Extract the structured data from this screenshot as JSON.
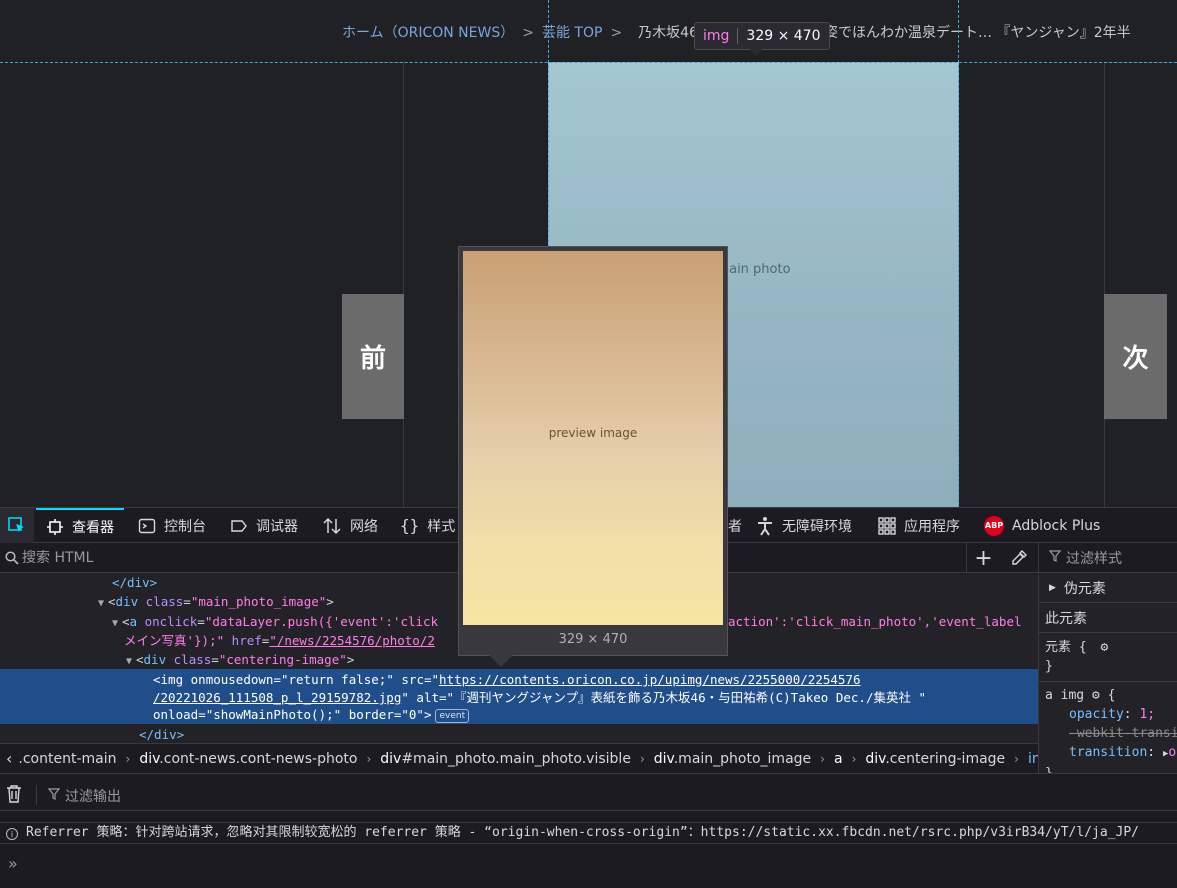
{
  "page": {
    "breadcrumb": {
      "home": "ホーム（ORICON NEWS）",
      "sep": ">",
      "category": "芸能 TOP",
      "current": "乃木坂46・与田祐希、メガネ姿でほんわか温泉デート… 『ヤンジャン』2年半"
    },
    "prev_label": "前",
    "next_label": "次",
    "main_photo_alt": "main photo",
    "tooltip": {
      "tag": "img",
      "dims": "329 × 470"
    }
  },
  "devtools": {
    "tabs": [
      {
        "label": "查看器",
        "active": true
      },
      {
        "label": "控制台"
      },
      {
        "label": "调试器"
      },
      {
        "label": "网络"
      },
      {
        "label": "样式"
      },
      {
        "label": "者"
      },
      {
        "label": "无障碍环境"
      },
      {
        "label": "应用程序"
      },
      {
        "label": "Adblock Plus"
      }
    ],
    "abp_badge": "ABP",
    "search_placeholder": "搜索 HTML",
    "markup": {
      "l1": "</div>",
      "l2": {
        "tag": "div",
        "attr": "class",
        "val": "\"main_photo_image\""
      },
      "l3": {
        "tag": "a",
        "attr1": "onclick",
        "val1": "\"dataLayer.push({'event':'click",
        "tail": "action':'click_main_photo','event_label",
        "line2": "メイン写真'});\"",
        "attr2": "href",
        "val2": "\"/news/2254576/photo/2"
      },
      "l4": {
        "tag": "div",
        "attr": "class",
        "val": "\"centering-image\""
      },
      "sel1": {
        "tag": "img",
        "attr1": "onmousedown",
        "val1": "\"return false;\"",
        "attr2": "src",
        "url1": "https://contents.oricon.co.jp/upimg/news/2255000/2254576"
      },
      "sel2": {
        "url2": "/20221026_111508_p_l_29159782.jpg",
        "q": "\"",
        "attr3": "alt",
        "val3": "\"『週刊ヤングジャンプ』表紙を飾る乃木坂46・与田祐希(C)Takeo Dec./集英社 \""
      },
      "sel3": {
        "attr4": "onload",
        "val4": "\"showMainPhoto();\"",
        "attr5": "border",
        "val5": "\"0\"",
        "badge": "event"
      },
      "l5": "</div>"
    },
    "crumbs": [
      {
        "text": ".content-main",
        "tag": ""
      },
      {
        "text": ".cont-news.cont-news-photo",
        "tag": "div"
      },
      {
        "text": "#main_photo.main_photo.visible",
        "tag": "div"
      },
      {
        "text": ".main_photo_image",
        "tag": "div"
      },
      {
        "text": "",
        "tag": "a"
      },
      {
        "text": ".centering-image",
        "tag": "div"
      },
      {
        "text": "",
        "tag": "img"
      }
    ],
    "rules": {
      "filter_placeholder": "过滤样式",
      "pseudo": "伪元素",
      "this_element": "此元素",
      "element_rule": "元素 {",
      "close": "}",
      "selector": "a img",
      "open": "{",
      "props": [
        {
          "name": "opacity",
          "value": "1;"
        },
        {
          "name": "-webkit-transi",
          "value": "",
          "struck": true
        },
        {
          "name": "transition",
          "value": "o"
        }
      ]
    },
    "console": {
      "filter_placeholder": "过滤输出",
      "message": "Referrer 策略：针对跨站请求，忽略对其限制较宽松的 referrer 策略 - “origin-when-cross-origin”：https://static.xx.fbcdn.net/rsrc.php/v3irB34/yT/l/ja_JP/",
      "prompt": "»"
    },
    "preview": {
      "dims": "329 × 470",
      "alt": "preview image"
    }
  },
  "colors": {
    "accent": "#00ddff",
    "selection": "#204e8a",
    "tag": "#75bfff",
    "attr": "#b98eff",
    "value": "#ff7de9"
  }
}
